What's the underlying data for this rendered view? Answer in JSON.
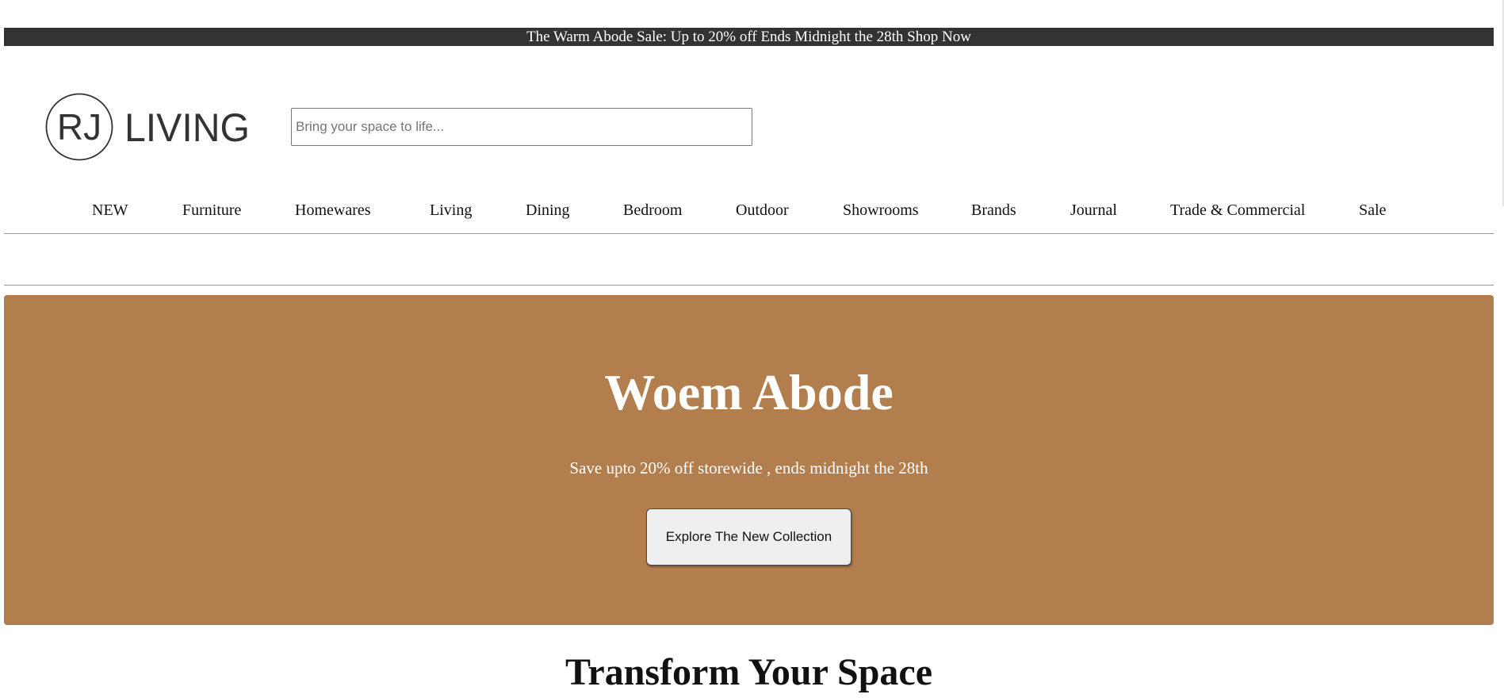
{
  "promo_bar": {
    "text": "The Warm Abode Sale: Up to 20% off Ends Midnight the 28th Shop Now"
  },
  "header": {
    "logo": {
      "monogram": "RJ",
      "wordmark": "LIVING"
    },
    "search": {
      "placeholder": "Bring your space to life...",
      "value": ""
    }
  },
  "nav": {
    "items": [
      {
        "label": "NEW"
      },
      {
        "label": "Furniture"
      },
      {
        "label": "Homewares"
      },
      {
        "label": "Living"
      },
      {
        "label": "Dining"
      },
      {
        "label": "Bedroom"
      },
      {
        "label": "Outdoor"
      },
      {
        "label": "Showrooms"
      },
      {
        "label": "Brands"
      },
      {
        "label": "Journal"
      },
      {
        "label": "Trade & Commercial"
      },
      {
        "label": "Sale"
      }
    ]
  },
  "hero": {
    "title": "Woem Abode",
    "subtitle": "Save upto 20% off storewide , ends midnight the 28th",
    "button_label": "Explore The New Collection",
    "background_color": "#b37e4d"
  },
  "section": {
    "title": "Transform Your Space"
  },
  "colors": {
    "promo_background": "#333333",
    "hero_background": "#b37e4d",
    "text": "#111111"
  }
}
